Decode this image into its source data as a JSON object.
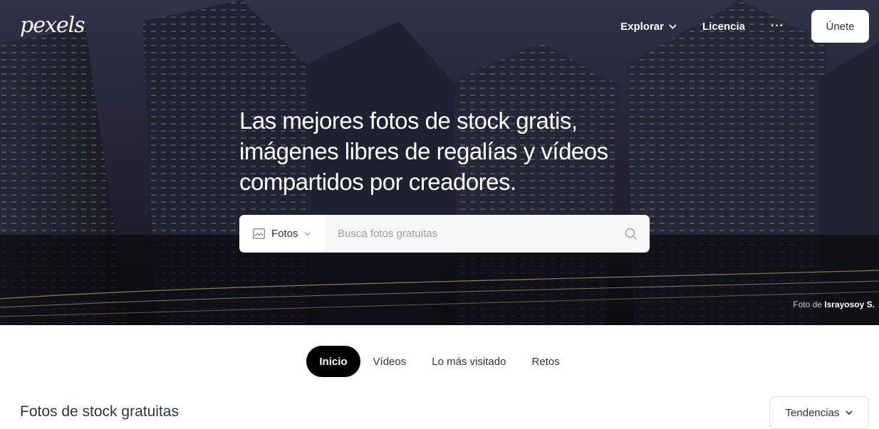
{
  "brand": {
    "logo_text": "pexels"
  },
  "nav": {
    "explore_label": "Explorar",
    "license_label": "Licencia",
    "more_label": "···",
    "join_label": "Únete"
  },
  "hero": {
    "headline": "Las mejores fotos de stock gratis, imágenes libres de regalías y vídeos compartidos por creadores.",
    "credit_prefix": "Foto de",
    "credit_author": "Israyosoy S."
  },
  "search": {
    "type_label": "Fotos",
    "placeholder": "Busca fotos gratuitas",
    "value": ""
  },
  "tabs": [
    {
      "label": "Inicio",
      "active": true
    },
    {
      "label": "Vídeos",
      "active": false
    },
    {
      "label": "Lo más visitado",
      "active": false
    },
    {
      "label": "Retos",
      "active": false
    }
  ],
  "feed": {
    "title": "Fotos de stock gratuitas",
    "sort_label": "Tendencias"
  },
  "colors": {
    "text_dark": "#2c343e",
    "tab_active_bg": "#000000",
    "search_bg": "#f7f7f7"
  },
  "icons": {
    "explore_chevron": "chevron-down-icon",
    "search_type_icon": "image-icon",
    "search_type_chevron": "chevron-down-icon",
    "search_submit": "search-icon",
    "sort_chevron": "chevron-down-icon"
  }
}
